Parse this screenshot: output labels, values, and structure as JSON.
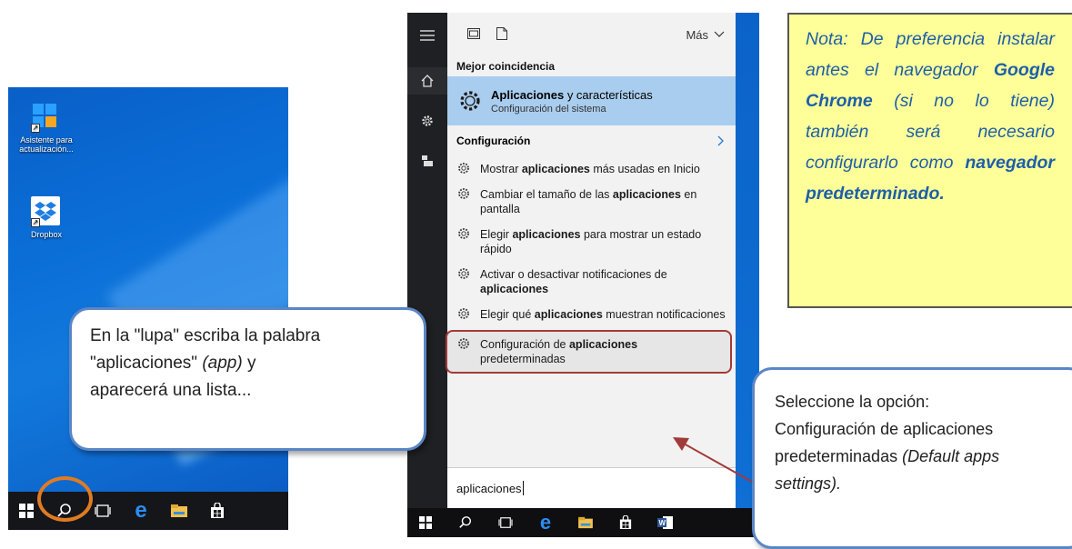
{
  "desktop": {
    "icons": [
      {
        "label": "Asistente para actualización..."
      },
      {
        "label": "Dropbox"
      }
    ]
  },
  "search": {
    "top_more_label": "Más",
    "best_match_heading": "Mejor coincidencia",
    "best_match": {
      "title_bold": "Aplicaciones",
      "title_rest": " y características",
      "subtitle": "Configuración del sistema"
    },
    "config_heading": "Configuración",
    "results": [
      {
        "pre": "Mostrar ",
        "bold": "aplicaciones",
        "post": " más usadas en Inicio"
      },
      {
        "pre": "Cambiar el tamaño de las ",
        "bold": "aplicaciones",
        "post": " en pantalla"
      },
      {
        "pre": "Elegir ",
        "bold": "aplicaciones",
        "post": " para mostrar un estado rápido"
      },
      {
        "pre": "Activar o desactivar notificaciones de ",
        "bold": "aplicaciones",
        "post": ""
      },
      {
        "pre": "Elegir qué ",
        "bold": "aplicaciones",
        "post": " muestran notificaciones"
      },
      {
        "pre": "Configuración de ",
        "bold": "aplicaciones",
        "post": " predeterminadas"
      }
    ],
    "query": "aplicaciones"
  },
  "callout_left": {
    "line1": "En la \"lupa\" escriba la palabra",
    "line2_pre": "\"aplicaciones\" ",
    "line2_em": "(app)",
    "line2_post": " y",
    "line3": "aparecerá una lista..."
  },
  "callout_right": {
    "line1": "Seleccione la opción:",
    "line2": "Configuración de aplicaciones",
    "line3_pre": "predeterminadas ",
    "line3_em": "(Default apps",
    "line4_em": "settings)."
  },
  "note": {
    "p1": "Nota: De preferencia instalar antes el navegador ",
    "b1": "Google Chrome",
    "p2": " (si no lo tiene) también será necesario configurarlo como ",
    "b2": "navegador predeterminado."
  },
  "colors": {
    "highlight_ring": "#e07b22",
    "callout_border": "#5a86c6",
    "note_bg": "#ffff99",
    "note_text": "#1f5fa8",
    "selection_bg": "#a9cdee",
    "arrow": "#a33a3a"
  }
}
